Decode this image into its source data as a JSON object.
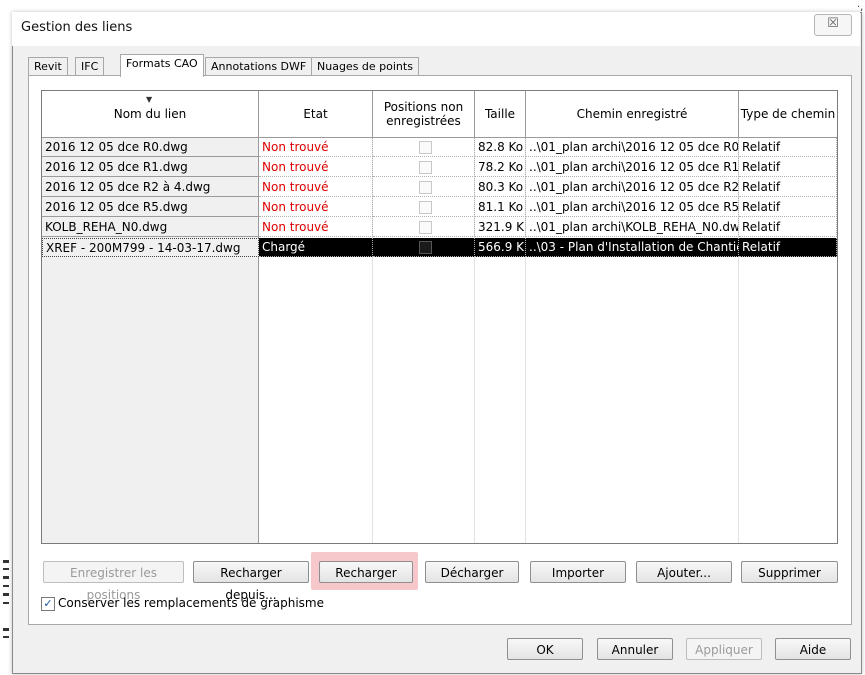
{
  "window": {
    "title": "Gestion des liens",
    "close_glyph": "☒",
    "corner_mark": "·,"
  },
  "tabs": [
    {
      "label": "Revit"
    },
    {
      "label": "IFC"
    },
    {
      "label": "Formats CAO"
    },
    {
      "label": "Annotations DWF"
    },
    {
      "label": "Nuages de points"
    }
  ],
  "table": {
    "headers": {
      "name": "Nom du lien",
      "state": "Etat",
      "positions": "Positions non enregistrées",
      "size": "Taille",
      "path": "Chemin enregistré",
      "path_type": "Type de chemin"
    },
    "rows": [
      {
        "name": "2016 12 05 dce R0.dwg",
        "state": "Non trouvé",
        "size": "82.8 Ko",
        "path": "..\\01_plan archi\\2016 12 05 dce R0.d",
        "path_type": "Relatif"
      },
      {
        "name": "2016 12 05 dce R1.dwg",
        "state": "Non trouvé",
        "size": "78.2 Ko",
        "path": "..\\01_plan archi\\2016 12 05 dce R1.d",
        "path_type": "Relatif"
      },
      {
        "name": "2016 12 05 dce R2 à 4.dwg",
        "state": "Non trouvé",
        "size": "80.3 Ko",
        "path": "..\\01_plan archi\\2016 12 05 dce R2 à",
        "path_type": "Relatif"
      },
      {
        "name": "2016 12 05 dce R5.dwg",
        "state": "Non trouvé",
        "size": "81.1 Ko",
        "path": "..\\01_plan archi\\2016 12 05 dce R5.d",
        "path_type": "Relatif"
      },
      {
        "name": "KOLB_REHA_N0.dwg",
        "state": "Non trouvé",
        "size": "321.9 K",
        "path": "..\\01_plan archi\\KOLB_REHA_N0.dw",
        "path_type": "Relatif"
      },
      {
        "name": "XREF - 200M799 - 14-03-17.dwg",
        "state": "Chargé",
        "size": "566.9 K",
        "path": "..\\03 - Plan d'Installation de Chantie",
        "path_type": "Relatif"
      }
    ]
  },
  "actions": {
    "save_positions": "Enregistrer les positions",
    "reload_from": "Recharger depuis...",
    "reload": "Recharger",
    "unload": "Décharger",
    "import": "Importer",
    "add": "Ajouter...",
    "remove": "Supprimer"
  },
  "options": {
    "keep_overrides": "Conserver les remplacements de graphisme",
    "keep_overrides_checked": true,
    "check_glyph": "✓"
  },
  "footer": {
    "ok": "OK",
    "cancel": "Annuler",
    "apply": "Appliquer",
    "help": "Aide"
  },
  "colors": {
    "missing": "#e00000",
    "highlight": "#f6c8cb",
    "selected_row": "#000000"
  }
}
